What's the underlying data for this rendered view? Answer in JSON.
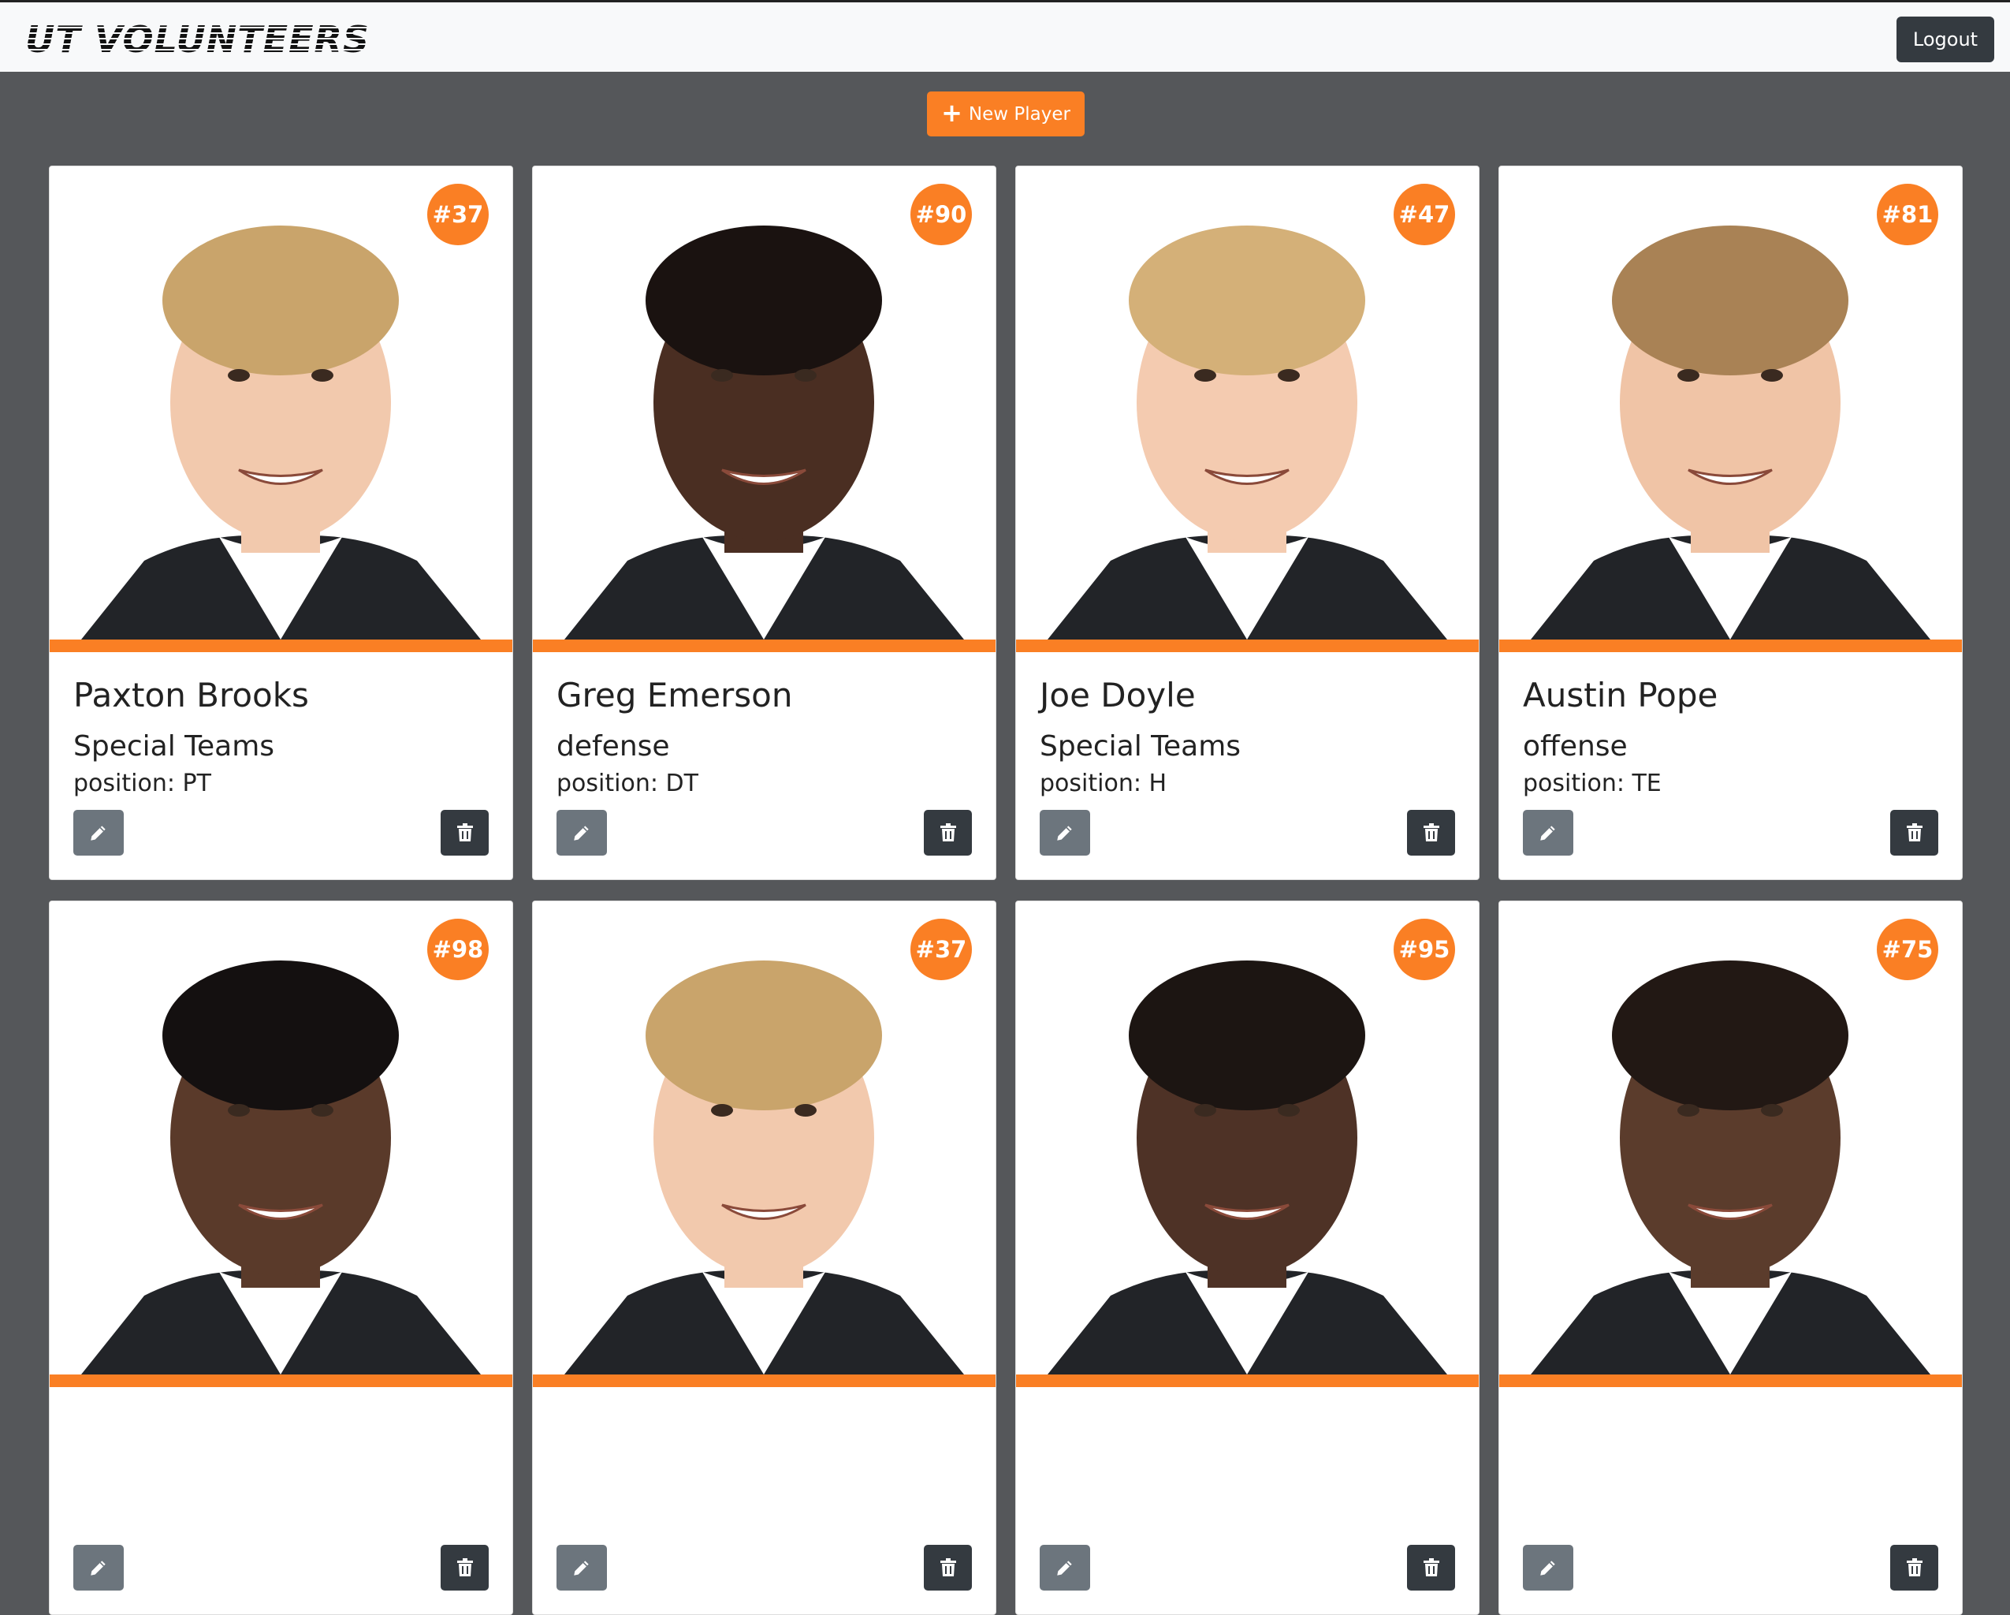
{
  "navbar": {
    "brand": "UT VOLUNTEERS",
    "logout_label": "Logout"
  },
  "toolbar": {
    "new_player_label": "New Player"
  },
  "colors": {
    "accent": "#fa7f24",
    "background": "#55575a",
    "dark_button": "#343a40",
    "edit_button": "#6c757d"
  },
  "players": [
    {
      "number": "#37",
      "name": "Paxton Brooks",
      "team": "Special Teams",
      "position": "position: PT",
      "skin": "#f2c9ad",
      "hair": "#c9a46b"
    },
    {
      "number": "#90",
      "name": "Greg Emerson",
      "team": "defense",
      "position": "position: DT",
      "skin": "#4a2e22",
      "hair": "#1a1210"
    },
    {
      "number": "#47",
      "name": "Joe Doyle",
      "team": "Special Teams",
      "position": "position: H",
      "skin": "#f4cbb0",
      "hair": "#d4b078"
    },
    {
      "number": "#81",
      "name": "Austin Pope",
      "team": "offense",
      "position": "position: TE",
      "skin": "#f0c4a6",
      "hair": "#a98255"
    },
    {
      "number": "#98",
      "skin": "#5a3a2a",
      "hair": "#141010"
    },
    {
      "number": "#37",
      "skin": "#f2c9ad",
      "hair": "#c9a46b"
    },
    {
      "number": "#95",
      "skin": "#4e3226",
      "hair": "#1c1512"
    },
    {
      "number": "#75",
      "skin": "#5b3c2c",
      "hair": "#221814"
    }
  ]
}
